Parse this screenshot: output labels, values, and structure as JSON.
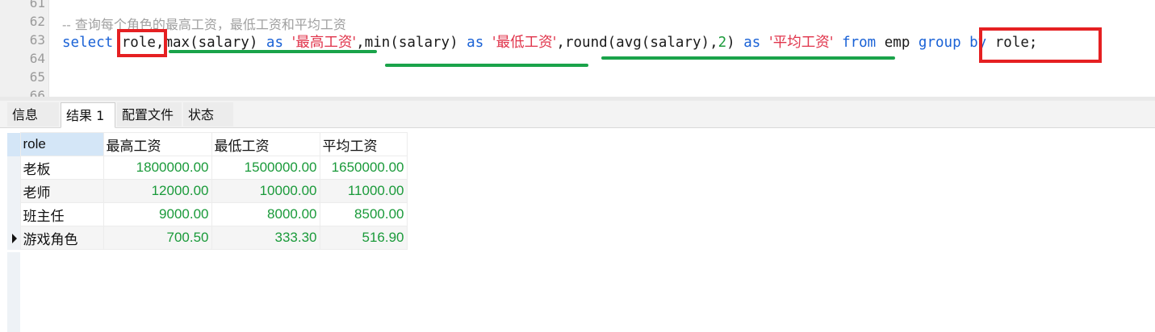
{
  "editor": {
    "line_numbers": [
      "61",
      "62",
      "63",
      "64",
      "65",
      "66"
    ],
    "comment": "-- 查询每个角色的最高工资，最低工资和平均工资",
    "sql": {
      "select": "select",
      "role": "role",
      "comma": ",",
      "max": "max(salary)",
      "as": "as",
      "alias_max": "'最高工资'",
      "min": "min(salary)",
      "alias_min": "'最低工资'",
      "round_open": "round(avg(salary),",
      "round_digits": "2",
      "round_close": ")",
      "alias_avg": "'平均工资'",
      "from": "from",
      "table": "emp",
      "group_by": "group by",
      "group_col": "role",
      "semicolon": ";"
    }
  },
  "tabs": [
    "信息",
    "结果 1",
    "配置文件",
    "状态"
  ],
  "result": {
    "columns": [
      "role",
      "最高工资",
      "最低工资",
      "平均工资"
    ],
    "rows": [
      [
        "老板",
        "1800000.00",
        "1500000.00",
        "1650000.00"
      ],
      [
        "老师",
        "12000.00",
        "10000.00",
        "11000.00"
      ],
      [
        "班主任",
        "9000.00",
        "8000.00",
        "8500.00"
      ],
      [
        "游戏角色",
        "700.50",
        "333.30",
        "516.90"
      ]
    ]
  },
  "annotations": {
    "box_color": "#e52022",
    "underline_color": "#1aa34a"
  }
}
